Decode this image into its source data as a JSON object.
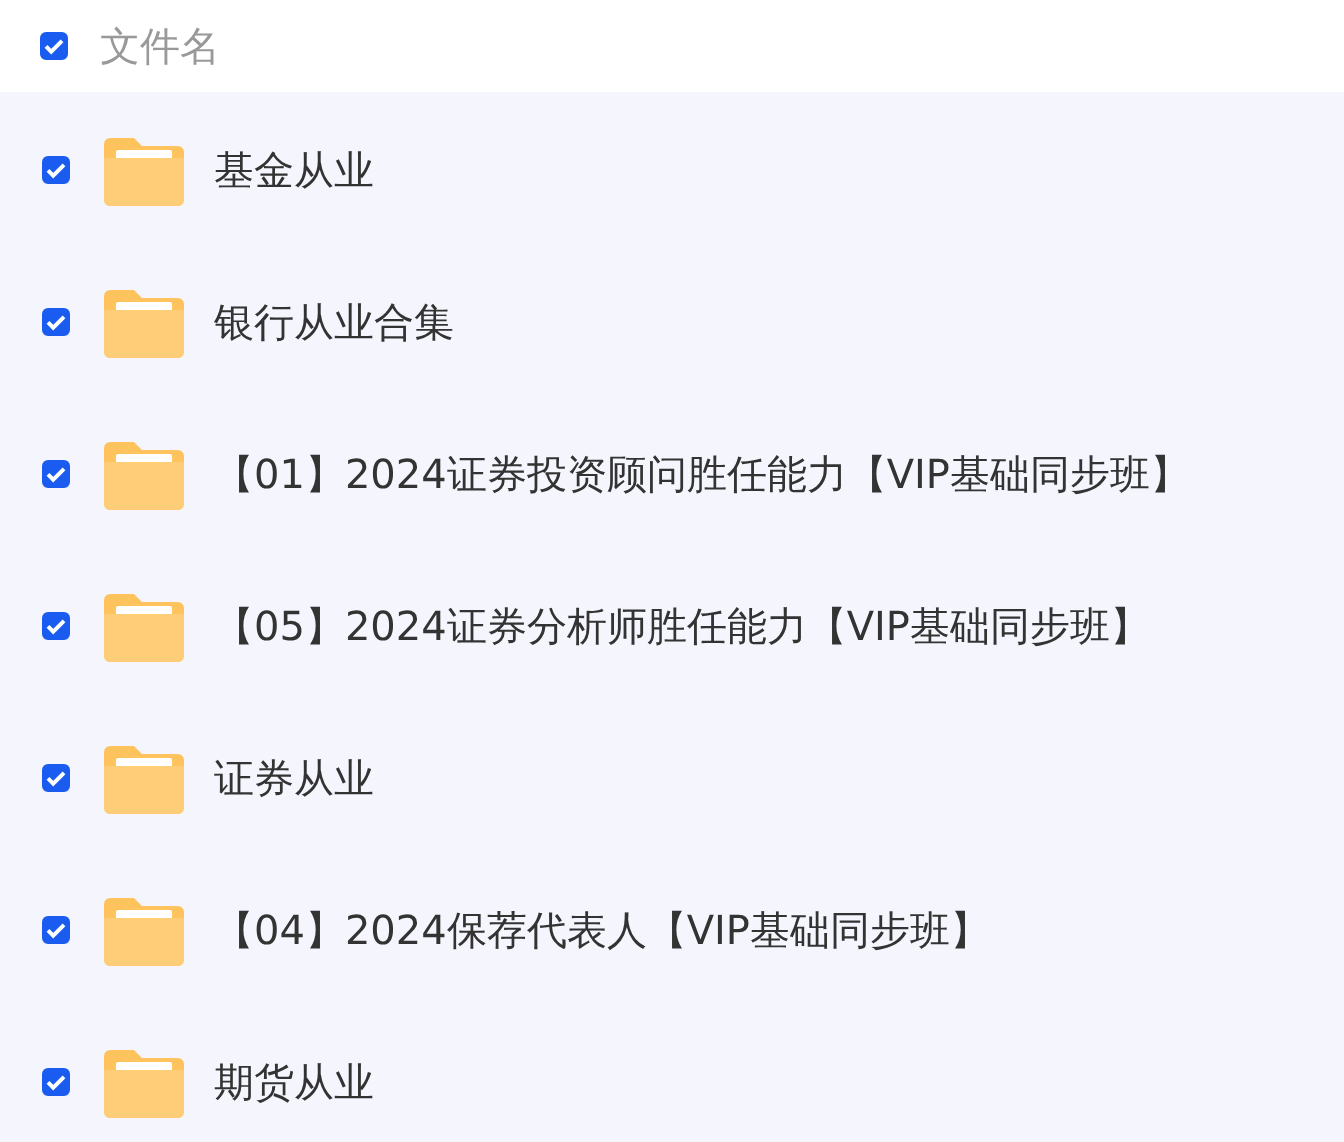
{
  "header": {
    "label": "文件名",
    "checked": true
  },
  "files": [
    {
      "name": "基金从业",
      "checked": true
    },
    {
      "name": "银行从业合集",
      "checked": true
    },
    {
      "name": "【01】2024证券投资顾问胜任能力【VIP基础同步班】",
      "checked": true
    },
    {
      "name": "【05】2024证券分析师胜任能力【VIP基础同步班】",
      "checked": true
    },
    {
      "name": "证券从业",
      "checked": true
    },
    {
      "name": "【04】2024保荐代表人【VIP基础同步班】",
      "checked": true
    },
    {
      "name": "期货从业",
      "checked": true
    }
  ]
}
